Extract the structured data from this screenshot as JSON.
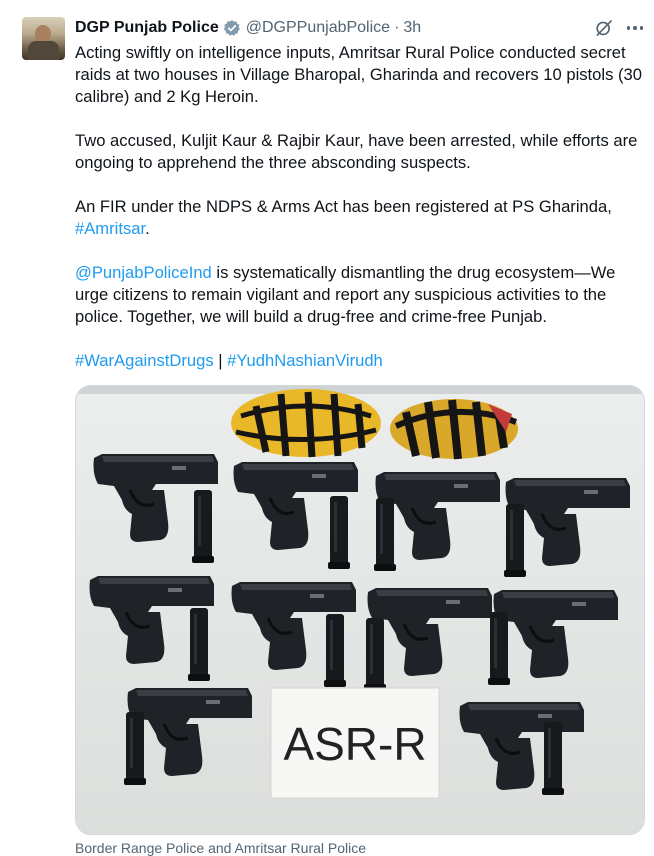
{
  "author": {
    "name": "DGP Punjab Police",
    "handle": "@DGPPunjabPolice",
    "separator": "·",
    "time": "3h",
    "verified_icon": "verified-badge-icon",
    "avatar": "avatar-photo"
  },
  "actions": {
    "grok_icon": "grok-icon",
    "more_icon": "more-options-icon"
  },
  "tweet": {
    "para1": "Acting swiftly on intelligence inputs, Amritsar Rural Police conducted secret raids at two houses in Village Bharopal, Gharinda and recovers 10 pistols (30 calibre) and 2 Kg Heroin.",
    "para2": "Two accused, Kuljit Kaur & Rajbir Kaur, have been arrested, while efforts are ongoing to apprehend the three absconding suspects.",
    "para3_text": "An FIR under the NDPS & Arms Act has been registered at PS Gharinda, ",
    "para3_hashtag": "#Amritsar",
    "para3_end": ".",
    "para4_mention": "@PunjabPoliceInd",
    "para4_text": " is systematically dismantling the drug ecosystem—We urge citizens to remain vigilant and report any suspicious activities to the police. Together, we will build a drug-free and crime-free Punjab.",
    "hashtag1": "#WarAgainstDrugs",
    "hashtag_sep": " | ",
    "hashtag2": "#YudhNashianVirudh"
  },
  "media": {
    "sign_text": "ASR-R",
    "pistol_count": 10,
    "magazine_count": 10,
    "packet_count": 2
  },
  "caption": "Border Range Police and Amritsar Rural Police",
  "colors": {
    "link": "#1d9bf0",
    "text": "#0f1419",
    "muted": "#536471",
    "verified": "#829aab"
  }
}
